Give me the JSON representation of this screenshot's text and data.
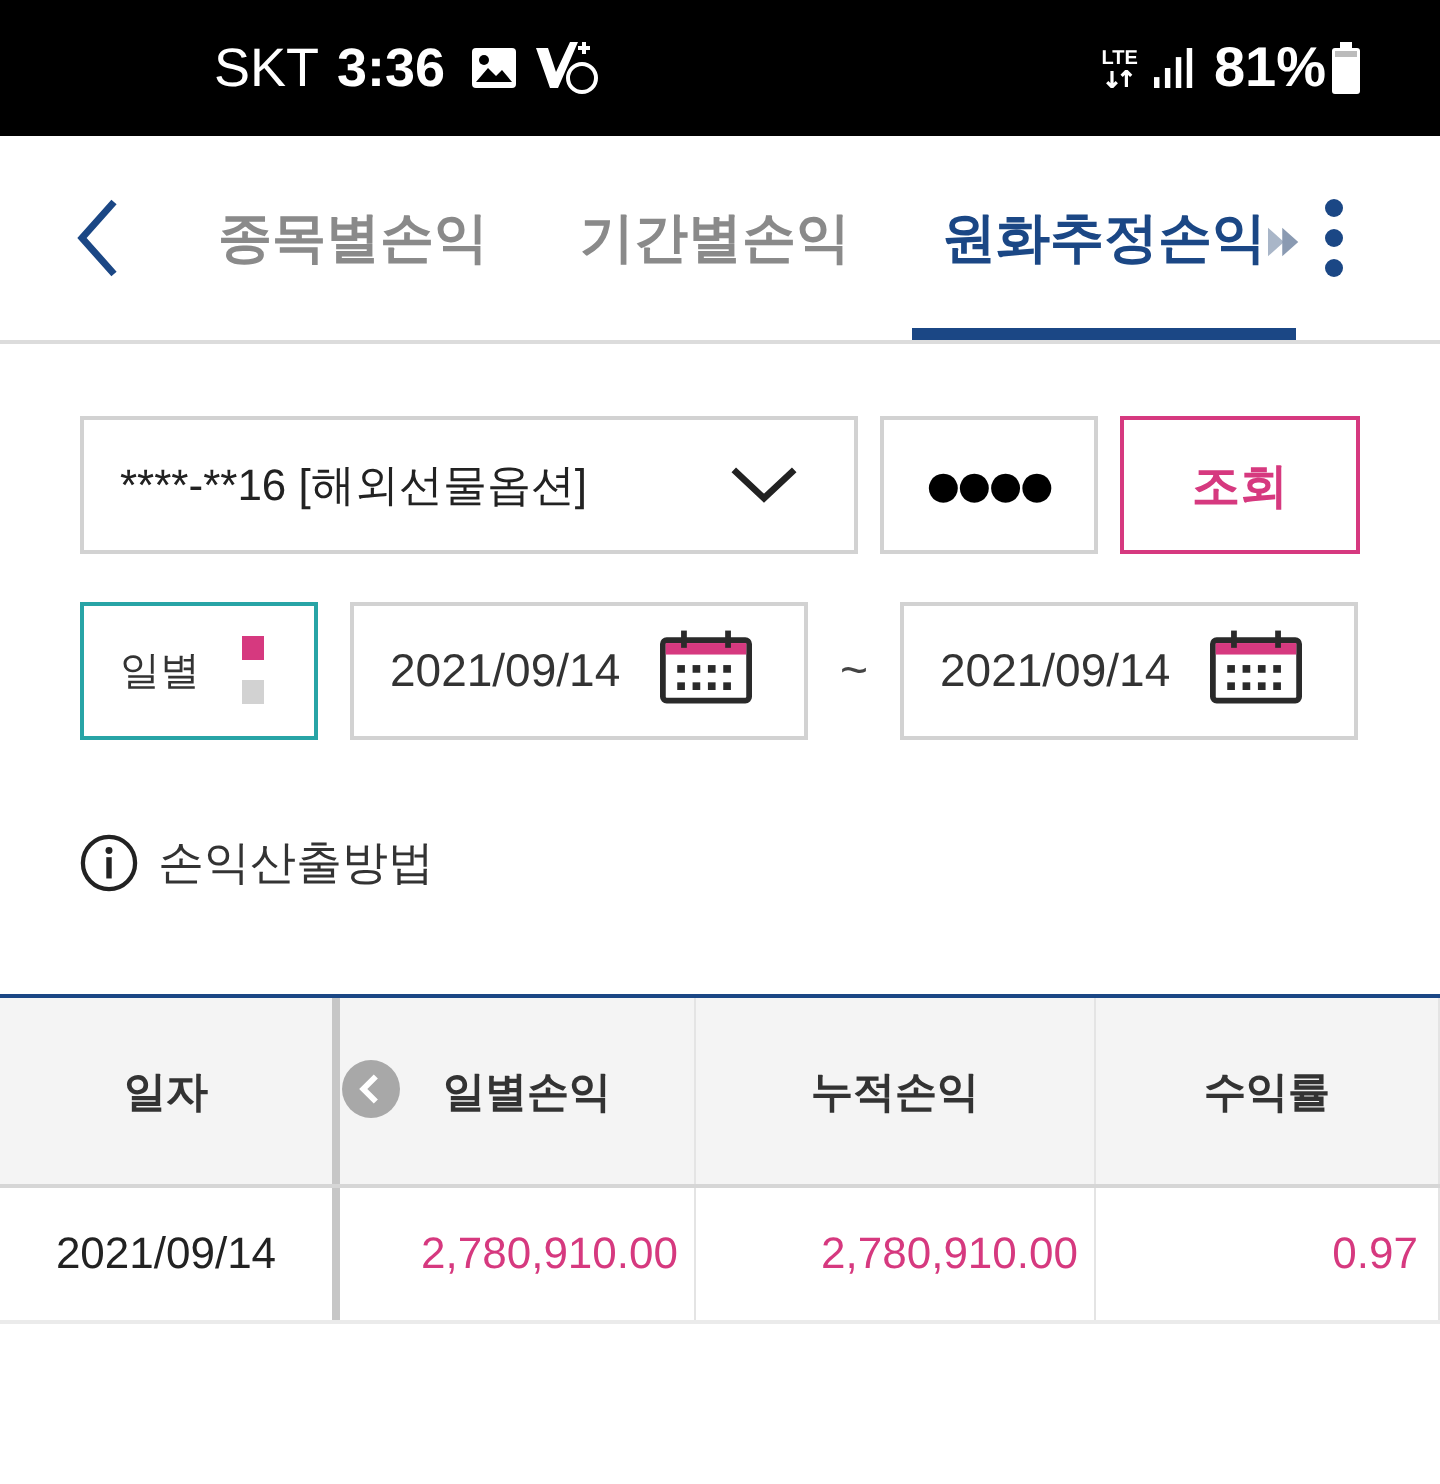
{
  "status_bar": {
    "carrier": "SKT",
    "time": "3:36",
    "network": "LTE",
    "battery": "81%"
  },
  "header": {
    "tabs": [
      {
        "label": "종목별손익",
        "selected": false
      },
      {
        "label": "기간별손익",
        "selected": false
      },
      {
        "label": "원화추정손익",
        "selected": true
      }
    ]
  },
  "filters": {
    "account": {
      "value": "****-**16 [해외선물옵션]"
    },
    "password": {
      "value": "●●●●"
    },
    "search_button": "조회",
    "period": {
      "label": "일별"
    },
    "date_from": {
      "value": "2021/09/14"
    },
    "separator": "~",
    "date_to": {
      "value": "2021/09/14"
    }
  },
  "info_link": "손익산출방법",
  "table": {
    "columns": [
      "일자",
      "일별손익",
      "누적손익",
      "수익률"
    ],
    "rows": [
      {
        "cells": [
          {
            "kind": "date",
            "text": "2021/09/14"
          },
          {
            "kind": "gain",
            "text": "2,780,910.00"
          },
          {
            "kind": "gain",
            "text": "2,780,910.00"
          },
          {
            "kind": "gain",
            "text": "0.97"
          }
        ]
      }
    ]
  }
}
